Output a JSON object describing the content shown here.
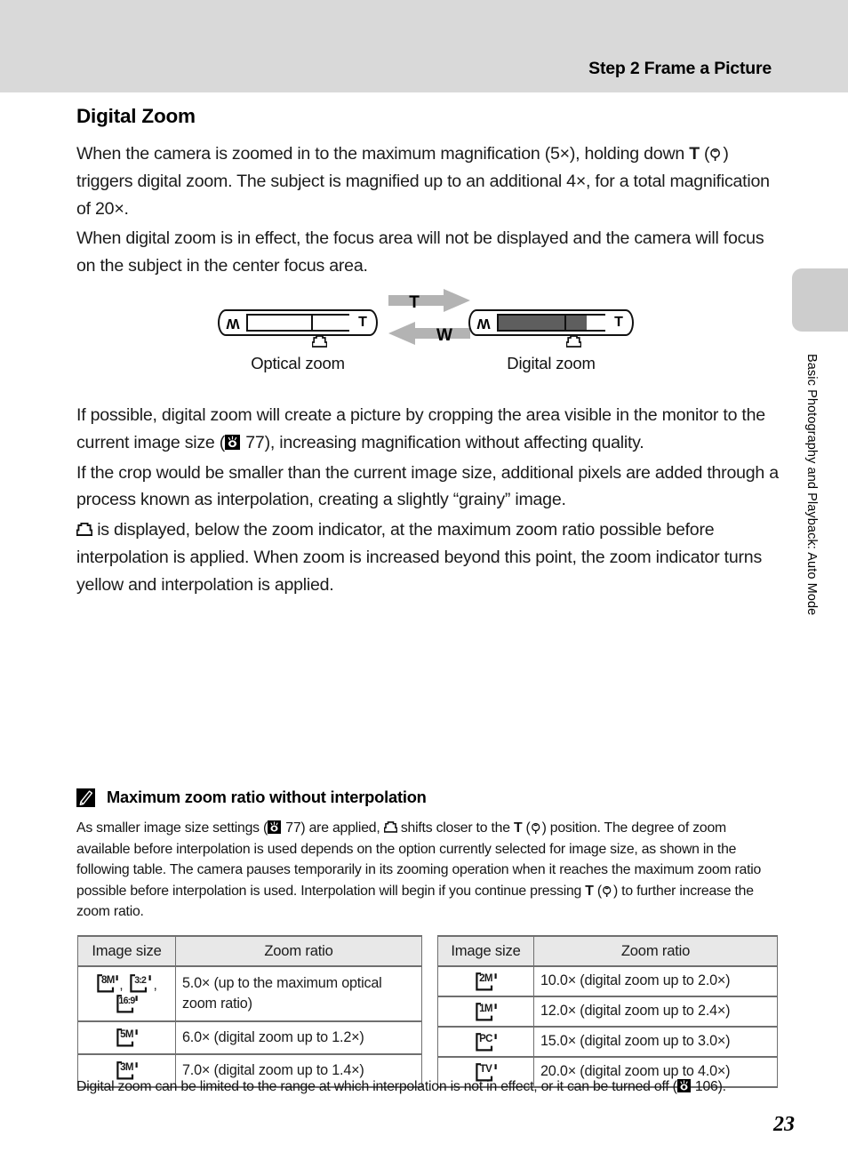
{
  "header": {
    "title": "Step 2 Frame a Picture"
  },
  "side_tab": {
    "label": "Basic Photography and Playback: Auto Mode"
  },
  "section": {
    "title": "Digital Zoom",
    "para1_a": "When the camera is zoomed in to the maximum magnification (5×), holding down ",
    "para1_t": "T",
    "para1_b": ") triggers digital zoom. The subject is magnified up to an additional 4×, for a total magnification of 20×.",
    "para2": "When digital zoom is in effect, the focus area will not be displayed and the camera will focus on the subject in the center focus area.",
    "para3_a": "If possible, digital zoom will create a picture by cropping the area visible in the monitor to the current image size (",
    "para3_ref": "77",
    "para3_b": "), increasing magnification without affecting quality.",
    "para4": "If the crop would be smaller than the current image size, additional pixels are added through a process known as interpolation, creating a slightly “grainy” image.",
    "para5": " is displayed, below the zoom indicator, at the maximum zoom ratio possible before interpolation is applied. When zoom is increased beyond this point, the zoom indicator turns yellow and interpolation is applied."
  },
  "figure": {
    "caption_left": "Optical zoom",
    "caption_right": "Digital zoom",
    "wide_label": "W",
    "tele_label": "T",
    "arrow_t_label": "T",
    "arrow_w_label": "W"
  },
  "note": {
    "heading": "Maximum zoom ratio without interpolation",
    "body_a": "As smaller image size settings (",
    "body_ref1": "77",
    "body_b": ") are applied, ",
    "body_c": " shifts closer to the ",
    "body_t1": "T",
    "body_d": ") position. The degree of zoom available before interpolation is used depends on the option currently selected for image size, as shown in the following table. The camera pauses temporarily in its zooming operation when it reaches the maximum zoom ratio possible before interpolation is used. Interpolation will begin if you continue pressing ",
    "body_t2": "T",
    "body_e": ") to further increase the zoom ratio."
  },
  "tables": {
    "columns": [
      "Image size",
      "Zoom ratio"
    ],
    "left_rows": [
      {
        "sizes": [
          "8M",
          "3:2",
          "16:9"
        ],
        "ratio": "5.0× (up to the maximum optical zoom ratio)"
      },
      {
        "sizes": [
          "5M"
        ],
        "ratio": "6.0× (digital zoom up to 1.2×)"
      },
      {
        "sizes": [
          "3M"
        ],
        "ratio": "7.0× (digital zoom up to 1.4×)"
      }
    ],
    "right_rows": [
      {
        "sizes": [
          "2M"
        ],
        "ratio": "10.0× (digital zoom up to 2.0×)"
      },
      {
        "sizes": [
          "1M"
        ],
        "ratio": "12.0× (digital zoom up to 2.4×)"
      },
      {
        "sizes": [
          "PC"
        ],
        "ratio": "15.0× (digital zoom up to 3.0×)"
      },
      {
        "sizes": [
          "TV"
        ],
        "ratio": "20.0× (digital zoom up to 4.0×)"
      }
    ]
  },
  "footnote": {
    "text_a": "Digital zoom can be limited to the range at which interpolation is not in effect, or it can be turned off (",
    "ref": "106",
    "text_b": ")."
  },
  "page_number": "23",
  "colors": {
    "header_band": "#d9d9d9",
    "side_tab": "#cdcdcd",
    "table_header": "#e8e8e8",
    "table_border": "#6f6f6f",
    "bar_fill": "#5e5e5e",
    "arrow": "#b3b3b3"
  }
}
